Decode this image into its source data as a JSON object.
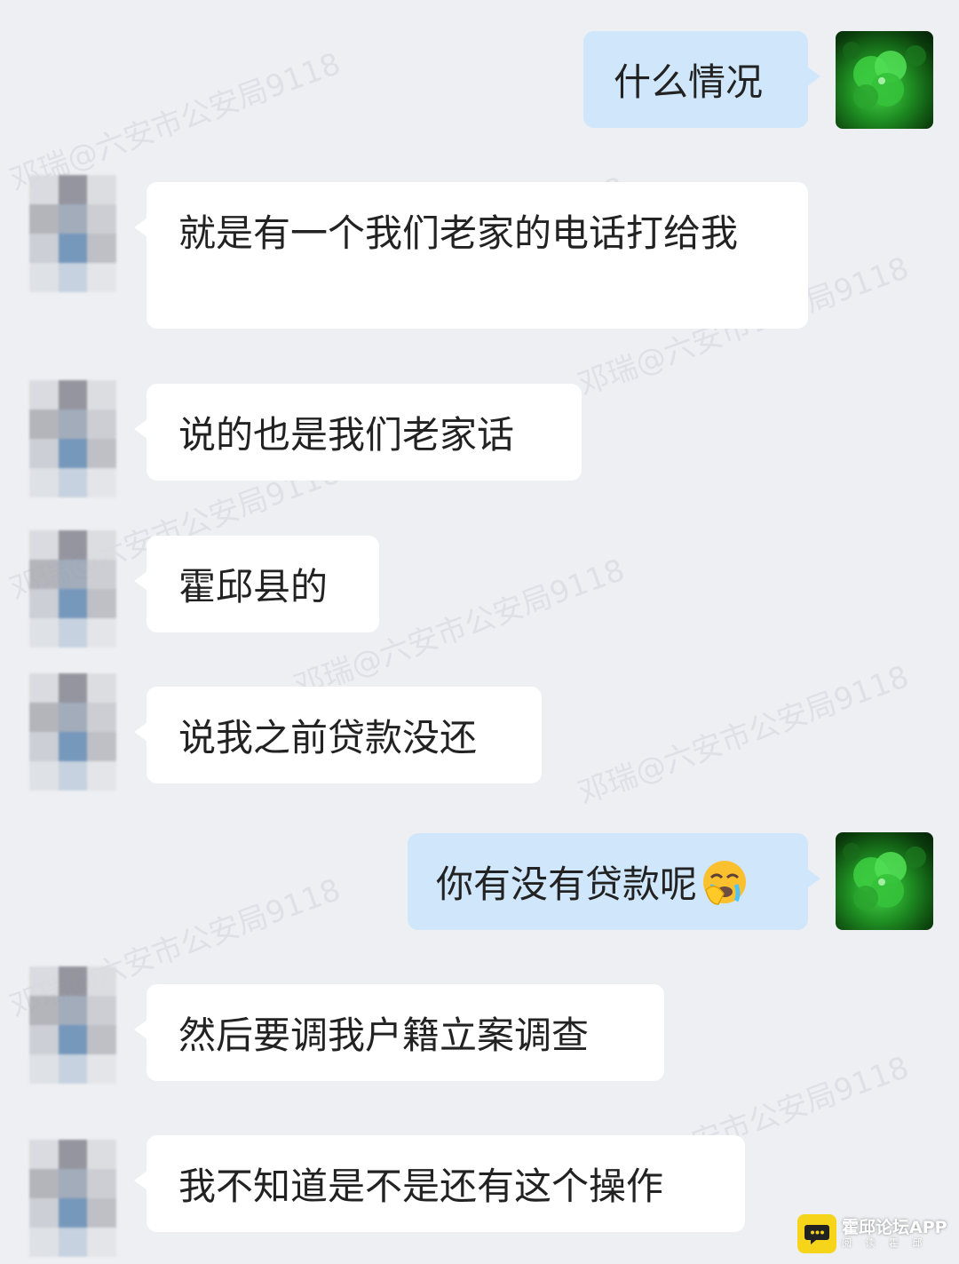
{
  "watermark_text": "邓瑞@六安市公安局9118",
  "messages": [
    {
      "side": "out",
      "text": "什么情况"
    },
    {
      "side": "in",
      "text": "就是有一个我们老家的电话打给我"
    },
    {
      "side": "in",
      "text": "说的也是我们老家话"
    },
    {
      "side": "in",
      "text": "霍邱县的"
    },
    {
      "side": "in",
      "text": "说我之前贷款没还"
    },
    {
      "side": "out",
      "text": "你有没有贷款呢",
      "emoji": "face-palm-crying-emoji"
    },
    {
      "side": "in",
      "text": "然后要调我户籍立案调查"
    },
    {
      "side": "in",
      "text": "我不知道是不是还有这个操作"
    }
  ],
  "brand": {
    "title": "霍邱论坛APP",
    "tagline": "阅 读 霍 邱",
    "accent_color": "#f5d41a"
  },
  "colors": {
    "background": "#eeeff3",
    "incoming_bubble": "#ffffff",
    "outgoing_bubble": "#cfe6fb"
  }
}
